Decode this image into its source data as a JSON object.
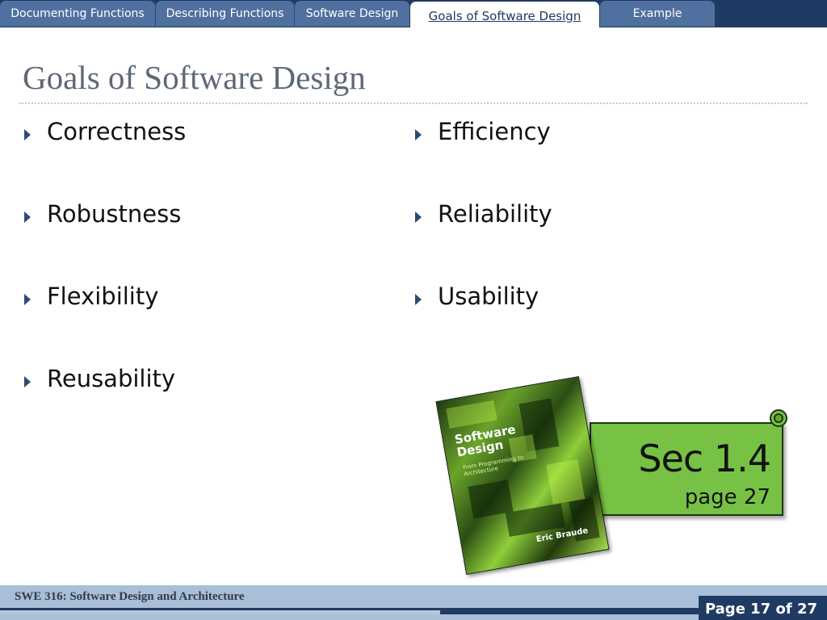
{
  "tabs": [
    {
      "label": "Documenting Functions",
      "active": false
    },
    {
      "label": "Describing Functions",
      "active": false
    },
    {
      "label": "Software Design",
      "active": false
    },
    {
      "label": "Goals of Software Design",
      "active": true
    },
    {
      "label": "Example",
      "active": false
    }
  ],
  "slide": {
    "title": "Goals of Software Design",
    "left_bullets": [
      "Correctness",
      "Robustness",
      "Flexibility",
      "Reusability"
    ],
    "right_bullets": [
      "Efficiency",
      "Reliability",
      "Usability"
    ]
  },
  "callout": {
    "section": "Sec 1.4",
    "page": "page 27",
    "color": "#77c244"
  },
  "book": {
    "title": "Software Design",
    "subtitle": "From Programming to Architecture",
    "author": "Eric Braude"
  },
  "footer": {
    "course": "SWE 316: Software Design and Architecture",
    "page_indicator": "Page 17 of 27"
  },
  "colors": {
    "nav_dark": "#1f3a63",
    "tab": "#50709f",
    "title_text": "#5e6876"
  }
}
